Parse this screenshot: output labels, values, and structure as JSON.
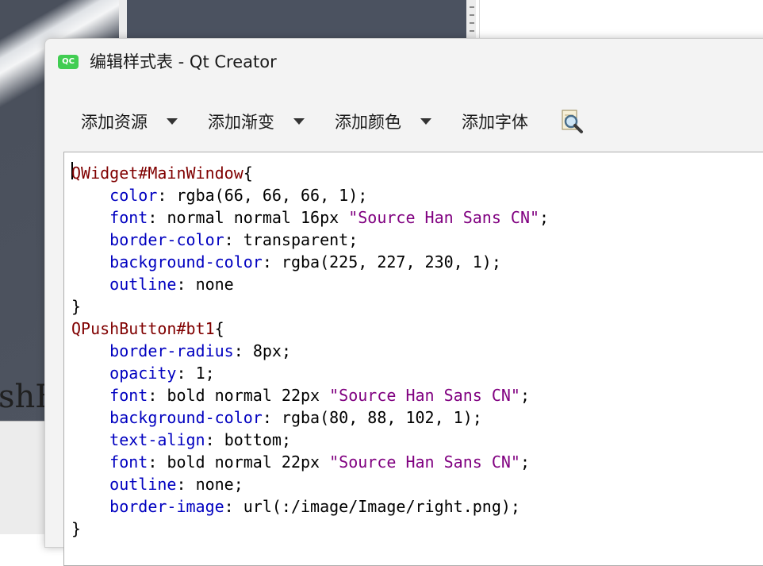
{
  "background": {
    "partial_text": "shB"
  },
  "window": {
    "icon_label": "QC",
    "title": "编辑样式表 - Qt Creator"
  },
  "toolbar": {
    "items": [
      {
        "label": "添加资源",
        "has_dropdown": true
      },
      {
        "label": "添加渐变",
        "has_dropdown": true
      },
      {
        "label": "添加颜色",
        "has_dropdown": true
      },
      {
        "label": "添加字体",
        "has_dropdown": false
      }
    ],
    "icon": "document-magnifier-icon"
  },
  "editor": {
    "lines": [
      {
        "selector": "QWidget#MainWindow",
        "open": "{"
      },
      {
        "prop": "color",
        "value": "rgba(66, 66, 66, 1)",
        "end": ";"
      },
      {
        "prop": "font",
        "value": "normal normal 16px ",
        "str": "\"Source Han Sans CN\"",
        "end": ";"
      },
      {
        "prop": "border-color",
        "value": "transparent",
        "end": ";"
      },
      {
        "prop": "background-color",
        "value": "rgba(225, 227, 230, 1)",
        "end": ";"
      },
      {
        "prop": "outline",
        "value": "none",
        "end": ""
      },
      {
        "close": "}"
      },
      {
        "selector": "QPushButton#bt1",
        "open": "{"
      },
      {
        "prop": "border-radius",
        "value": "8px",
        "end": ";"
      },
      {
        "prop": "opacity",
        "value": "1",
        "end": ";"
      },
      {
        "prop": "font",
        "value": "bold normal 22px ",
        "str": "\"Source Han Sans CN\"",
        "end": ";"
      },
      {
        "prop": "background-color",
        "value": "rgba(80, 88, 102, 1)",
        "end": ";"
      },
      {
        "prop": "text-align",
        "value": "bottom",
        "end": ";"
      },
      {
        "prop": "font",
        "value": "bold normal 22px ",
        "str": "\"Source Han Sans CN\"",
        "end": ";"
      },
      {
        "prop": "outline",
        "value": "none",
        "end": ";"
      },
      {
        "prop": "border-image",
        "value": "url(:/image/Image/right.png)",
        "end": ";"
      },
      {
        "close": "}"
      }
    ],
    "colors": {
      "selector": "#800000",
      "property": "#0000c0",
      "string": "#800080"
    }
  }
}
